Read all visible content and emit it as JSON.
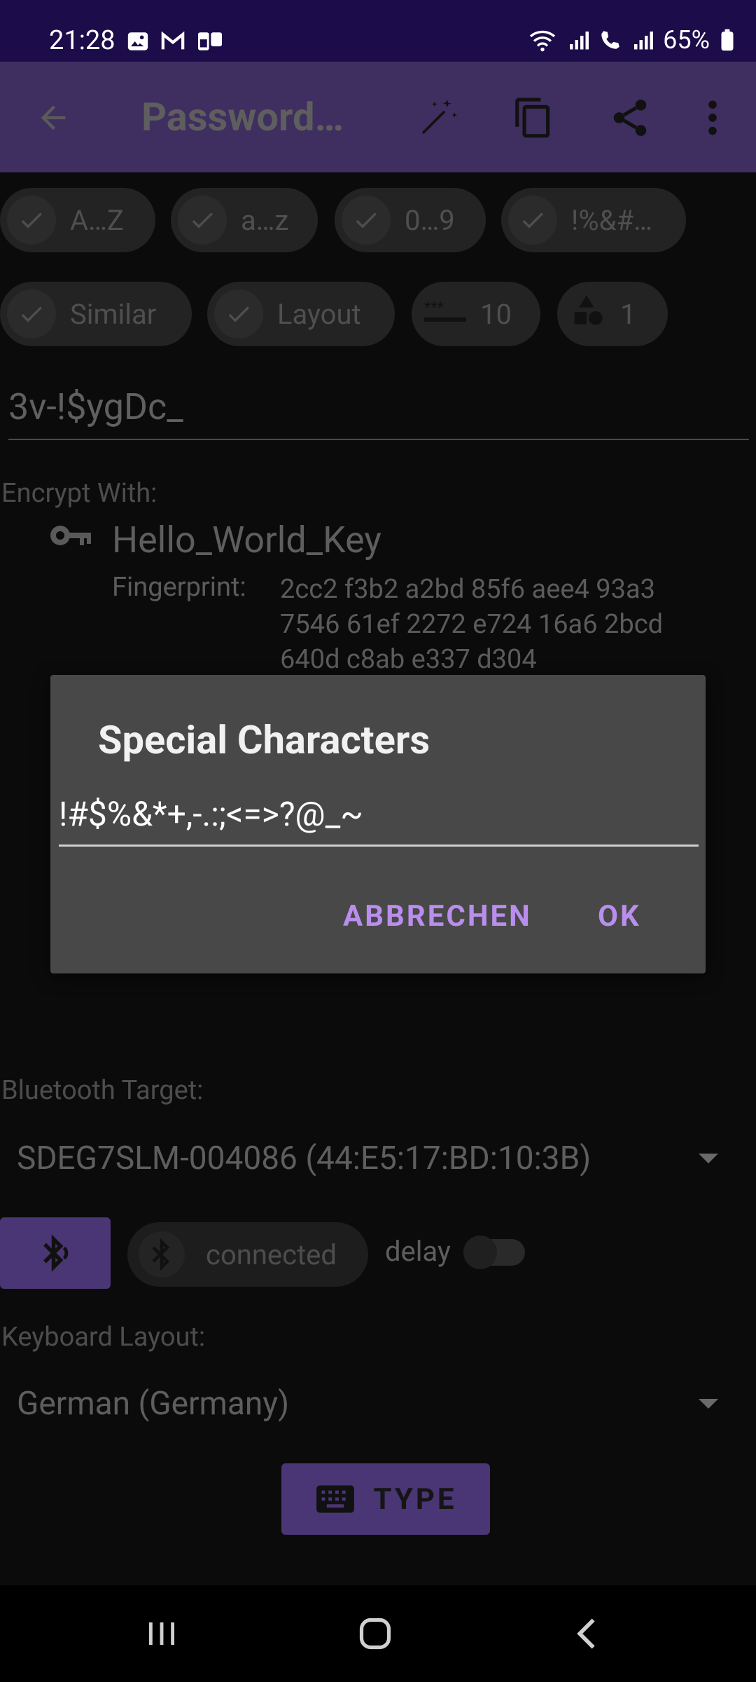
{
  "status_bar": {
    "time": "21:28",
    "battery": "65%",
    "icons_left": [
      "image-icon",
      "mail-icon",
      "sim-icon"
    ],
    "icons_right": [
      "wifi-icon",
      "signal-icon",
      "call-icon",
      "signal-icon",
      "battery-icon"
    ]
  },
  "app_bar": {
    "title": "Password…",
    "actions": [
      "back-icon",
      "magic-wand-icon",
      "copy-icon",
      "share-icon",
      "more-icon"
    ]
  },
  "chips_row1": [
    {
      "label": "A…Z",
      "checked": true
    },
    {
      "label": "a…z",
      "checked": true
    },
    {
      "label": "0…9",
      "checked": true
    },
    {
      "label": "!%&#…",
      "checked": true
    }
  ],
  "chips_row2": [
    {
      "label": "Similar",
      "checked": true
    },
    {
      "label": "Layout",
      "checked": true
    },
    {
      "label": "10",
      "icon": "length-icon"
    },
    {
      "label": "1",
      "icon": "shapes-icon"
    }
  ],
  "password": "3v-!$ygDc_",
  "encrypt": {
    "label": "Encrypt With:",
    "key_name": "Hello_World_Key",
    "fingerprint_label": "Fingerprint:",
    "fingerprint_lines": [
      "2cc2 f3b2 a2bd 85f6 aee4 93a3",
      "7546 61ef 2272 e724 16a6 2bcd",
      "640d c8ab e337 d304"
    ]
  },
  "dialog": {
    "title": "Special Characters",
    "input_value": "!#$%&*+,-.:;<=>?@_~",
    "cancel": "ABBRECHEN",
    "ok": "OK"
  },
  "bluetooth": {
    "label": "Bluetooth Target:",
    "device": "SDEG7SLM-004086 (44:E5:17:BD:10:3B)",
    "status": "connected",
    "delay_label": "delay"
  },
  "keyboard": {
    "label": "Keyboard Layout:",
    "value": "German (Germany)"
  },
  "type_button": "TYPE",
  "colors": {
    "status_bar": "#1c0c49",
    "app_bar": "#3f2f60",
    "accent": "#b98eec",
    "button": "#4a3575"
  }
}
